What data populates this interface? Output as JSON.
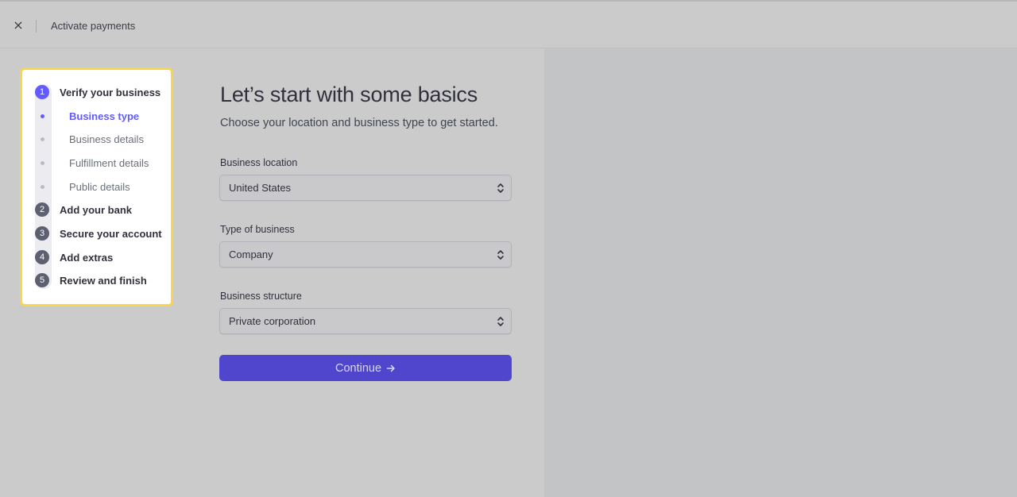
{
  "header": {
    "close_icon": "×",
    "title": "Activate payments"
  },
  "stepper": {
    "steps": [
      {
        "number": "1",
        "label": "Verify your business",
        "active": true,
        "substeps": [
          {
            "label": "Business type",
            "active": true
          },
          {
            "label": "Business details",
            "active": false
          },
          {
            "label": "Fulfillment details",
            "active": false
          },
          {
            "label": "Public details",
            "active": false
          }
        ]
      },
      {
        "number": "2",
        "label": "Add your bank",
        "active": false
      },
      {
        "number": "3",
        "label": "Secure your account",
        "active": false
      },
      {
        "number": "4",
        "label": "Add extras",
        "active": false
      },
      {
        "number": "5",
        "label": "Review and finish",
        "active": false
      }
    ]
  },
  "form": {
    "heading": "Let’s start with some basics",
    "subheading": "Choose your location and business type to get started.",
    "fields": [
      {
        "label": "Business location",
        "value": "United States"
      },
      {
        "label": "Type of business",
        "value": "Company"
      },
      {
        "label": "Business structure",
        "value": "Private corporation"
      }
    ],
    "continue_label": "Continue"
  },
  "colors": {
    "accent": "#635bff",
    "button": "#4f46cd",
    "highlight_border": "#f8d54a"
  }
}
